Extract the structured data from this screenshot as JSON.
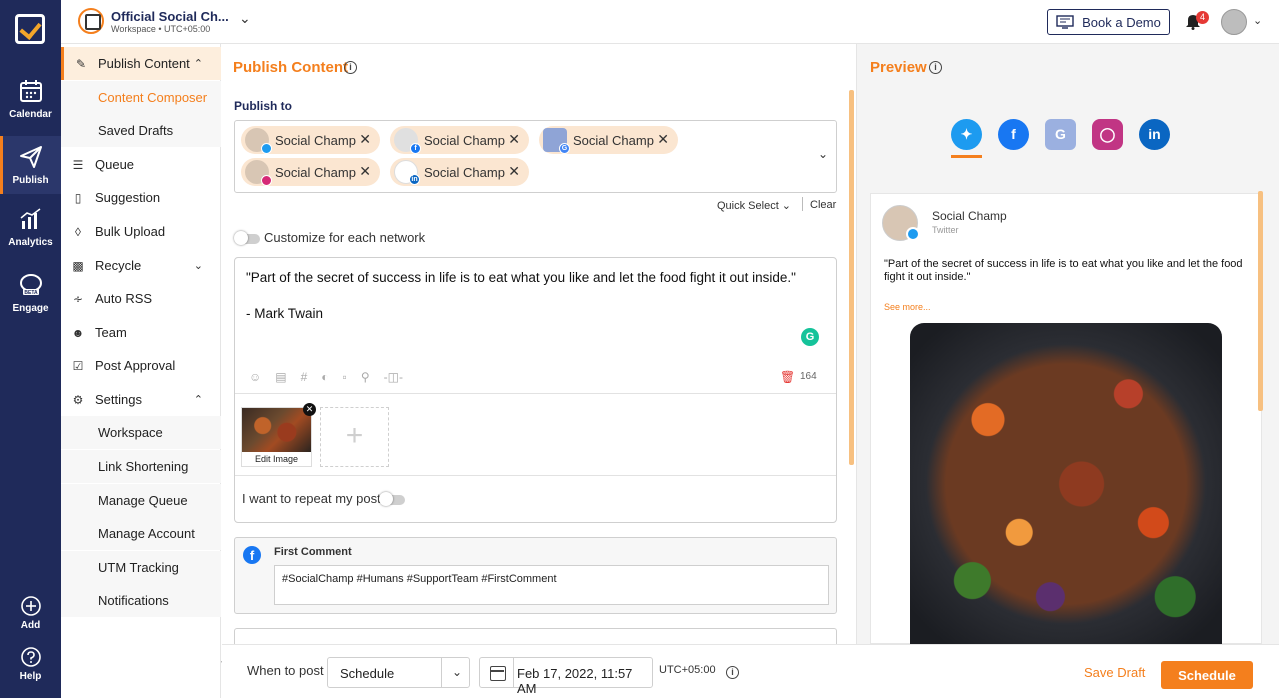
{
  "rail": {
    "items": [
      {
        "label": "Calendar",
        "icon": "calendar-icon"
      },
      {
        "label": "Publish",
        "icon": "paper-plane-icon"
      },
      {
        "label": "Analytics",
        "icon": "bar-chart-icon"
      },
      {
        "label": "Engage",
        "icon": "chat-bubbles-icon"
      },
      {
        "label": "Add",
        "icon": "plus-circle-icon"
      },
      {
        "label": "Help",
        "icon": "question-circle-icon"
      }
    ],
    "engage_badge": "BETA"
  },
  "topbar": {
    "workspace_name": "Official Social Ch...",
    "workspace_sub": "Workspace • UTC+05:00",
    "book_demo": "Book a Demo",
    "notification_count": "4"
  },
  "sidebar": {
    "publish_content": "Publish Content",
    "content_composer": "Content Composer",
    "saved_drafts": "Saved Drafts",
    "queue": "Queue",
    "suggestion": "Suggestion",
    "bulk_upload": "Bulk Upload",
    "recycle": "Recycle",
    "auto_rss": "Auto RSS",
    "team": "Team",
    "post_approval": "Post Approval",
    "settings": "Settings",
    "workspace": "Workspace",
    "link_shortening": "Link Shortening",
    "manage_queue": "Manage Queue",
    "manage_account": "Manage Account",
    "utm_tracking": "UTM Tracking",
    "notifications": "Notifications"
  },
  "publish": {
    "title": "Publish Content",
    "publish_to": "Publish to",
    "accounts": [
      {
        "name": "Social Champ",
        "network": "twitter"
      },
      {
        "name": "Social Champ",
        "network": "facebook"
      },
      {
        "name": "Social Champ",
        "network": "google-business"
      },
      {
        "name": "Social Champ",
        "network": "instagram"
      },
      {
        "name": "Social Champ",
        "network": "linkedin"
      }
    ],
    "quick_select": "Quick Select",
    "clear": "Clear",
    "customize": "Customize for each network",
    "post_text": "\"Part of the secret of success in life is to eat what you like and let the food fight it out inside.\"\n\n- Mark Twain",
    "char_count": "164",
    "edit_image": "Edit Image",
    "repeat_label": "I want to repeat my post",
    "first_comment_title": "First Comment",
    "first_comment_text": "#SocialChamp #Humans #SupportTeam #FirstComment"
  },
  "preview": {
    "title": "Preview",
    "networks": [
      "twitter",
      "facebook",
      "google-business",
      "instagram",
      "linkedin"
    ],
    "card_name": "Social Champ",
    "card_network": "Twitter",
    "card_text": "\"Part of the secret of success in life is to eat what you like and let the food fight it out inside.\"",
    "see_more": "See more..."
  },
  "footer": {
    "when_label": "When to post",
    "when_value": "Schedule",
    "date_value": "Feb 17, 2022, 11:57 AM",
    "timezone": "UTC+05:00",
    "save_draft": "Save Draft",
    "schedule": "Schedule"
  },
  "colors": {
    "accent": "#f47f1d",
    "rail_bg": "#1f2a5a",
    "twitter": "#1d9bf0",
    "facebook": "#1877f2",
    "linkedin": "#0a66c2"
  }
}
